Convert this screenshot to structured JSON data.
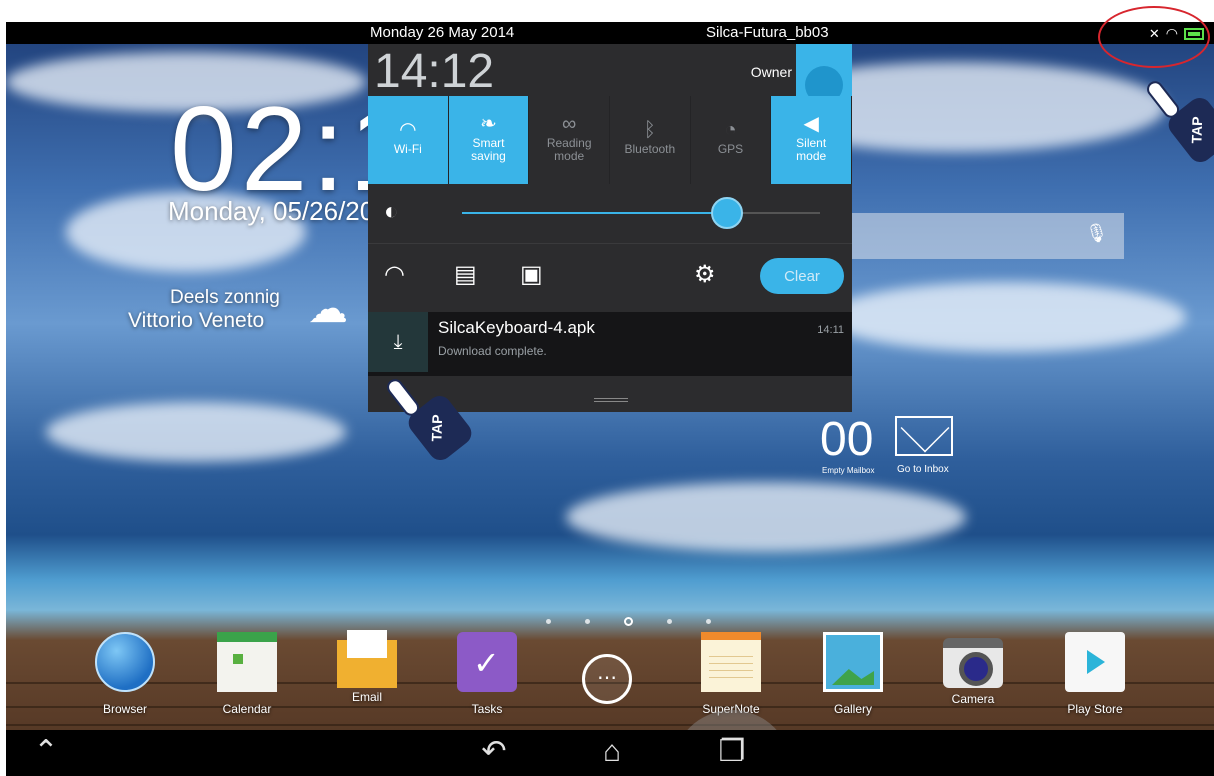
{
  "status_bar": {
    "date": "Monday 26 May 2014",
    "ssid": "Silca-Futura_bb03",
    "icons": [
      "mute-icon",
      "wifi-icon",
      "battery-icon"
    ]
  },
  "home": {
    "clock": "02:1",
    "date": "Monday, 05/26/20",
    "weather_condition": "Deels zonnig",
    "weather_location": "Vittorio Veneto",
    "mail_count": "00",
    "mail_label": "Empty Mailbox",
    "inbox_label": "Go to Inbox"
  },
  "panel": {
    "time": "14:12",
    "owner": "Owner",
    "quick_settings": [
      {
        "label": "Wi-Fi",
        "icon": "wifi-icon",
        "on": true
      },
      {
        "label": "Smart saving",
        "icon": "leaf-icon",
        "on": true
      },
      {
        "label": "Reading mode",
        "icon": "glasses-icon",
        "on": false
      },
      {
        "label": "Bluetooth",
        "icon": "bluetooth-icon",
        "on": false
      },
      {
        "label": "GPS",
        "icon": "gps-icon",
        "on": false
      },
      {
        "label": "Silent mode",
        "icon": "speaker-icon",
        "on": true
      }
    ],
    "brightness": 0.74,
    "clear_label": "Clear",
    "notification": {
      "title": "SilcaKeyboard-4.apk",
      "subtitle": "Download complete.",
      "time": "14:11"
    }
  },
  "annotations": {
    "tap_label": "TAP"
  },
  "dock": [
    {
      "label": "Browser"
    },
    {
      "label": "Calendar"
    },
    {
      "label": "Email"
    },
    {
      "label": "Tasks"
    },
    {
      "label": "SuperNote"
    },
    {
      "label": "Gallery"
    },
    {
      "label": "Camera"
    },
    {
      "label": "Play Store"
    }
  ],
  "page_indicator": {
    "count": 5,
    "active": 2
  }
}
